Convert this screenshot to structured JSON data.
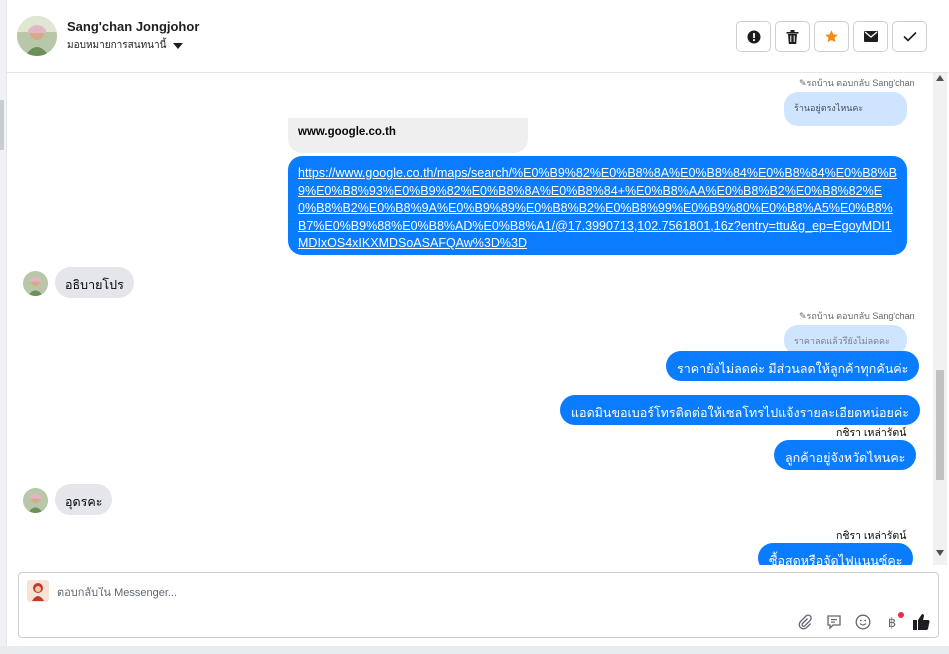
{
  "header": {
    "name": "Sang'chan Jongjohor",
    "assign_label": "มอบหมายการสนทนานี้"
  },
  "colors": {
    "accent_blue": "#0a7cff",
    "quote_blue": "#cfe5ff",
    "star_orange": "#f28b12"
  },
  "actions": [
    {
      "icon": "alert-icon"
    },
    {
      "icon": "trash-icon"
    },
    {
      "icon": "star-icon"
    },
    {
      "icon": "mail-icon"
    },
    {
      "icon": "check-icon"
    }
  ],
  "messages": {
    "reply1_meta": "✎รถบ้าน ตอบกลับ Sang'chan",
    "reply1_quote": "ร้านอยู่ตรงไหนคะ",
    "link_preview_title": "www.google.co.th",
    "link_url": "https://www.google.co.th/maps/search/%E0%B9%82%E0%B8%8A%E0%B8%84%E0%B8%84%E0%B8%B9%E0%B8%93%E0%B9%82%E0%B8%8A%E0%B8%84+%E0%B8%AA%E0%B8%B2%E0%B8%82%E0%B8%B2%E0%B8%9A%E0%B9%89%E0%B8%B2%E0%B8%99%E0%B9%80%E0%B8%A5%E0%B8%B7%E0%B9%88%E0%B8%AD%E0%B8%A1/@17.3990713,102.7561801,16z?entry=ttu&g_ep=EgoyMDI1MDIxOS4xIKXMDSoASAFQAw%3D%3D",
    "incoming1": "อธิบายโปร",
    "reply2_meta": "✎รถบ้าน ตอบกลับ Sang'chan",
    "reply2_quote": "ราคาลดแล้วรึยังไม่ลดคะ",
    "outgoing1": "ราคายังไม่ลดค่ะ มีส่วนลดให้ลูกค้าทุกคันค่ะ",
    "outgoing2": "แอดมินขอเบอร์โทรติดต่อให้เซลโทรไปแจ้งรายละเอียดหน่อยค่ะ",
    "sender1": "กชิรา เหล่ารัตน์",
    "outgoing3": "ลูกค้าอยู่จังหวัดไหนคะ",
    "incoming2": "อุดรคะ",
    "sender2": "กชิรา เหล่ารัตน์",
    "outgoing4": "ซื้อสดหรือจัดไฟแนนซ์คะ"
  },
  "composer": {
    "placeholder": "ตอบกลับใน Messenger...",
    "tools": [
      "attachment-icon",
      "saved-reply-icon",
      "emoji-icon",
      "payment-icon",
      "like-icon"
    ]
  }
}
